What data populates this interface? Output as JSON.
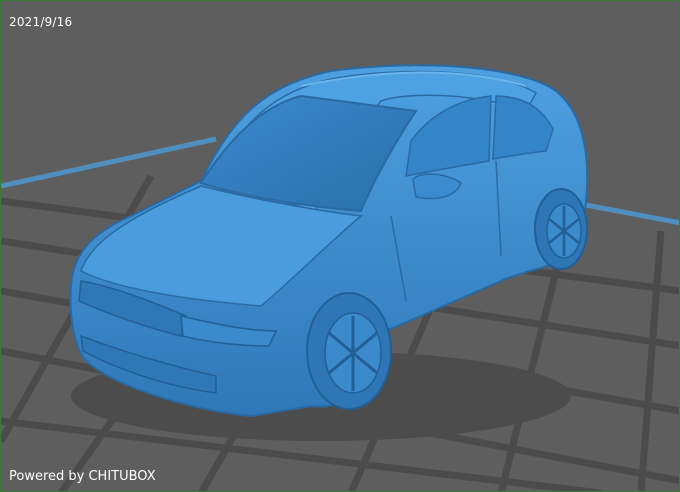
{
  "viewport": {
    "date": "2021/9/16",
    "footer_text": "Powered by CHITUBOX",
    "background_color": "#5e5e5e",
    "grid_color": "#4a4a4a",
    "platform_border_color": "#4e8fbf",
    "model_color": "#3f8fd0",
    "model_name": "car-model"
  }
}
